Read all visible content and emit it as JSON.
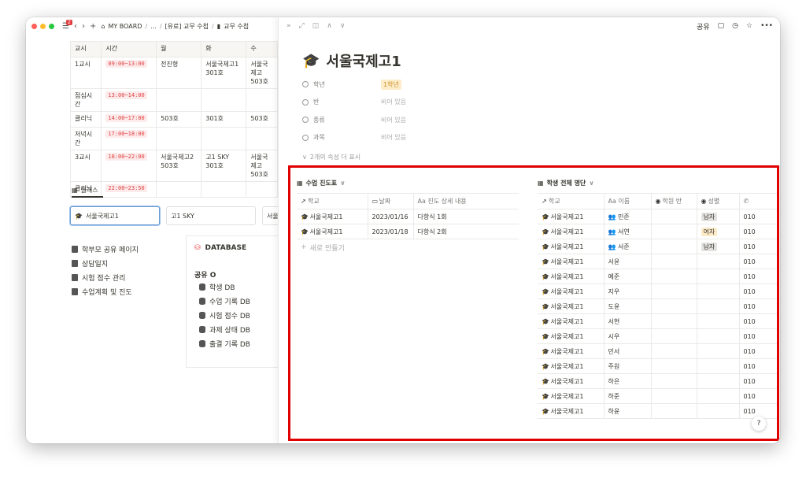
{
  "nav": {
    "badge": "2",
    "crumbs": [
      "MY BOARD",
      "...",
      "[유료] 교무 수첩",
      "교무 수첩"
    ]
  },
  "timetable": {
    "headers": [
      "교시",
      "시간",
      "월",
      "화",
      "수"
    ],
    "rows": [
      [
        "1교시",
        "09:00~13:00",
        "전진형",
        "서울국제고1\n301호",
        "서울국제고\n503호"
      ],
      [
        "점심시간",
        "13:00~14:00",
        "",
        "",
        ""
      ],
      [
        "클리닉",
        "14:00~17:00",
        "503호",
        "301호",
        "503호"
      ],
      [
        "저녁시간",
        "17:00~18:00",
        "",
        "",
        ""
      ],
      [
        "3교시",
        "18:00~22:00",
        "서울국제고2\n503호",
        "고1 SKY\n301호",
        "서울국제고\n503호"
      ],
      [
        "클리닉",
        "22:00~23:50",
        "",
        "",
        ""
      ]
    ]
  },
  "classes": {
    "tab": "클래스",
    "cards": [
      "서울국제고1",
      "고1 SKY",
      "서울"
    ]
  },
  "links": [
    "학부모 공유 페이지",
    "상담일지",
    "시험 점수 관리",
    "수업계획 및 진도"
  ],
  "database": {
    "title": "DATABASE",
    "share": "공유 O",
    "items": [
      "학생 DB",
      "수업 기록 DB",
      "시험 점수 DB",
      "과제 상태 DB",
      "출결 기록 DB"
    ]
  },
  "side": {
    "share_label": "공유",
    "title": "서울국제고1",
    "properties": [
      {
        "label": "학년",
        "value": "1학년"
      },
      {
        "label": "반",
        "value": "비어 있음"
      },
      {
        "label": "종류",
        "value": "비어 있음"
      },
      {
        "label": "과목",
        "value": "비어 있음"
      }
    ],
    "more_props": "2개의 속성 더 표시"
  },
  "progress_db": {
    "title": "수업 진도표",
    "headers": [
      "학교",
      "날짜",
      "Aa 진도 상세 내용"
    ],
    "rows": [
      [
        "서울국제고1",
        "2023/01/16",
        "다항식 1회"
      ],
      [
        "서울국제고1",
        "2023/01/18",
        "다항식 2회"
      ]
    ],
    "new_row": "새로 만들기"
  },
  "students_db": {
    "title": "학생 전체 명단",
    "headers": [
      "학교",
      "Aa 이름",
      "학원 반",
      "성별",
      ""
    ],
    "rows": [
      [
        "서울국제고1",
        "민준",
        "",
        "남자",
        "010"
      ],
      [
        "서울국제고1",
        "서연",
        "",
        "여자",
        "010"
      ],
      [
        "서울국제고1",
        "서준",
        "",
        "남자",
        "010"
      ],
      [
        "서울국제고1",
        "서윤",
        "",
        "",
        "010"
      ],
      [
        "서울국제고1",
        "예준",
        "",
        "",
        "010"
      ],
      [
        "서울국제고1",
        "지우",
        "",
        "",
        "010"
      ],
      [
        "서울국제고1",
        "도윤",
        "",
        "",
        "010"
      ],
      [
        "서울국제고1",
        "서현",
        "",
        "",
        "010"
      ],
      [
        "서울국제고1",
        "시우",
        "",
        "",
        "010"
      ],
      [
        "서울국제고1",
        "민서",
        "",
        "",
        "010"
      ],
      [
        "서울국제고1",
        "주원",
        "",
        "",
        "010"
      ],
      [
        "서울국제고1",
        "하은",
        "",
        "",
        "010"
      ],
      [
        "서울국제고1",
        "하준",
        "",
        "",
        "010"
      ],
      [
        "서울국제고1",
        "하윤",
        "",
        "",
        "010"
      ]
    ]
  },
  "help": "?"
}
